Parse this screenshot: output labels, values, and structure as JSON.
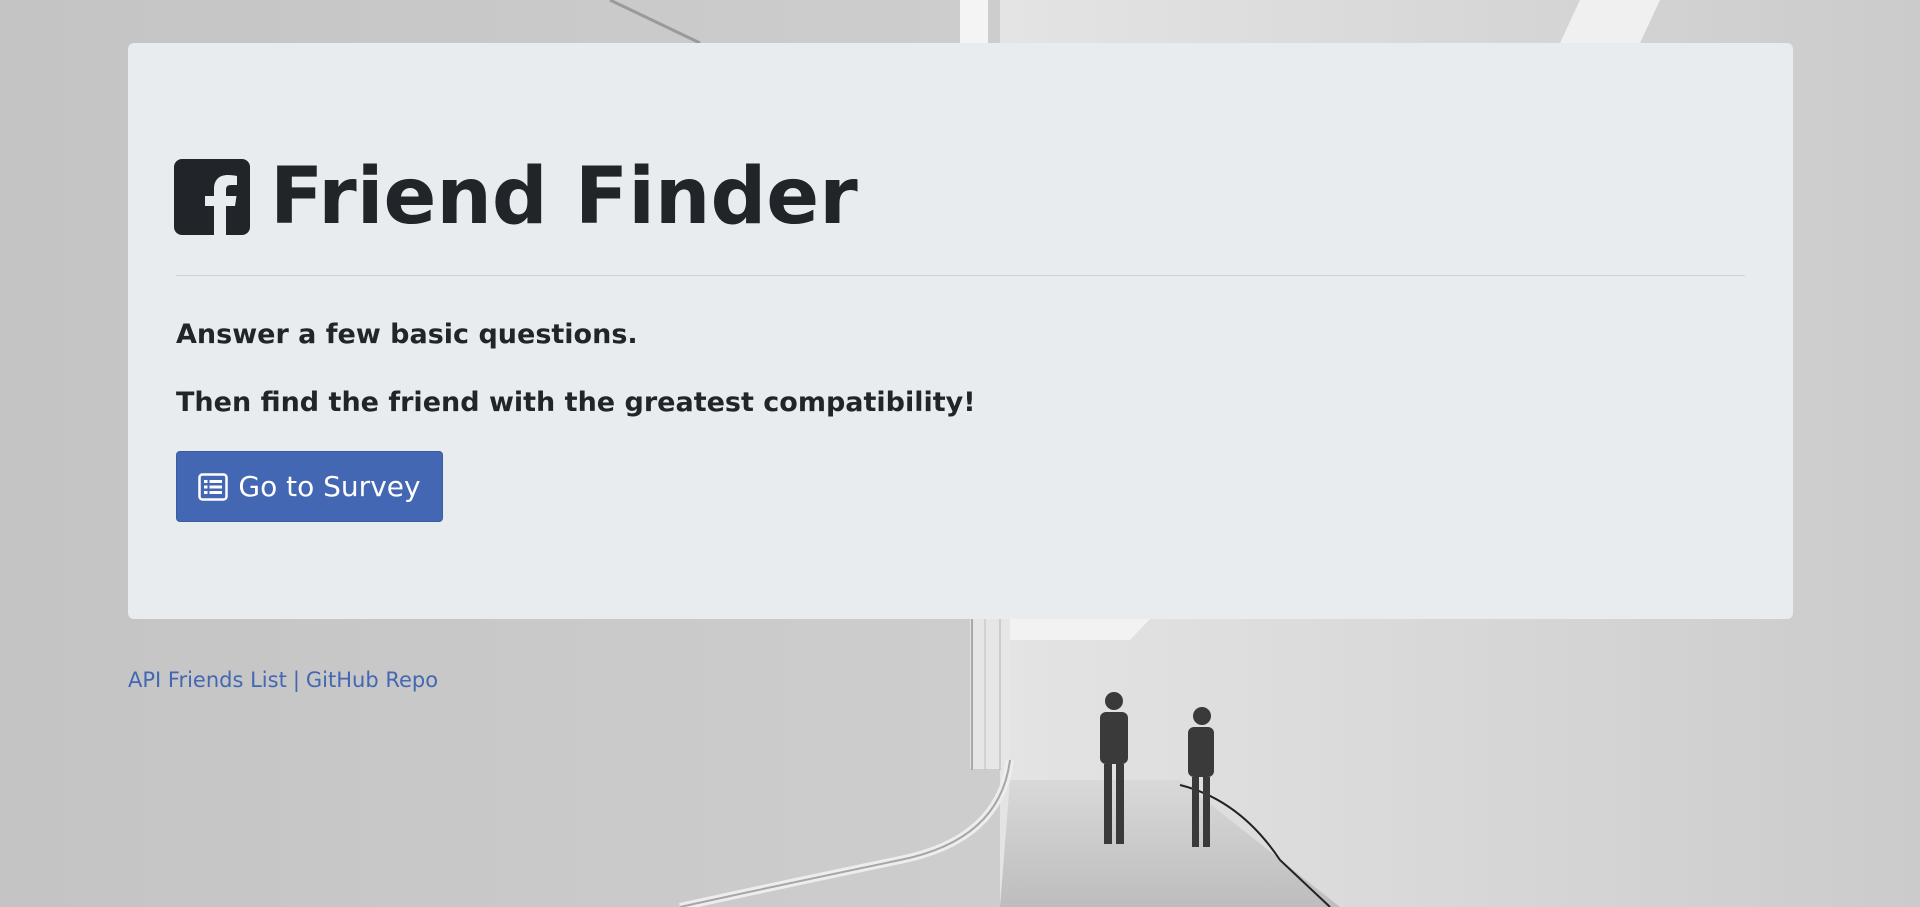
{
  "header": {
    "title": "Friend Finder",
    "logo_icon": "facebook-square-icon"
  },
  "main": {
    "lead_1": "Answer a few basic questions.",
    "lead_2": "Then find the friend with the greatest compatibility!",
    "survey_button_label": "Go to Survey",
    "survey_button_icon": "list-alt-icon"
  },
  "footer": {
    "api_link": "API Friends List",
    "separator": "|",
    "github_link": "GitHub Repo"
  },
  "colors": {
    "jumbotron_bg": "#e9ecef",
    "primary": "#4467b4",
    "text": "#212529"
  }
}
